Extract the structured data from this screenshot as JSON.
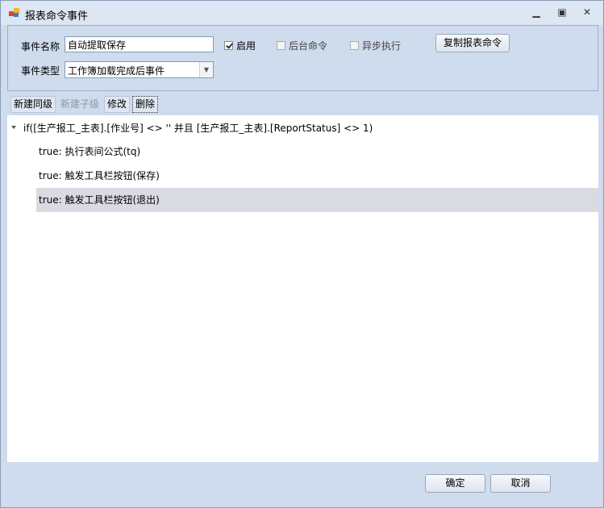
{
  "window": {
    "title": "报表命令事件"
  },
  "form": {
    "event_name_label": "事件名称",
    "event_name_value": "自动提取保存",
    "enable_label": "启用",
    "enable_checked": true,
    "background_label": "后台命令",
    "async_label": "异步执行",
    "copy_button": "复制报表命令",
    "event_type_label": "事件类型",
    "event_type_value": "工作簿加载完成后事件"
  },
  "toolbar": {
    "new_sibling": "新建同级",
    "new_child": "新建子级",
    "edit": "修改",
    "delete": "删除"
  },
  "tree": {
    "root": "if([生产报工_主表].[作业号] <> '' 并且 [生产报工_主表].[ReportStatus] <> 1)",
    "children": [
      "true: 执行表间公式(tq)",
      "true: 触发工具栏按钮(保存)",
      "true: 触发工具栏按钮(退出)"
    ]
  },
  "footer": {
    "ok": "确定",
    "cancel": "取消"
  }
}
